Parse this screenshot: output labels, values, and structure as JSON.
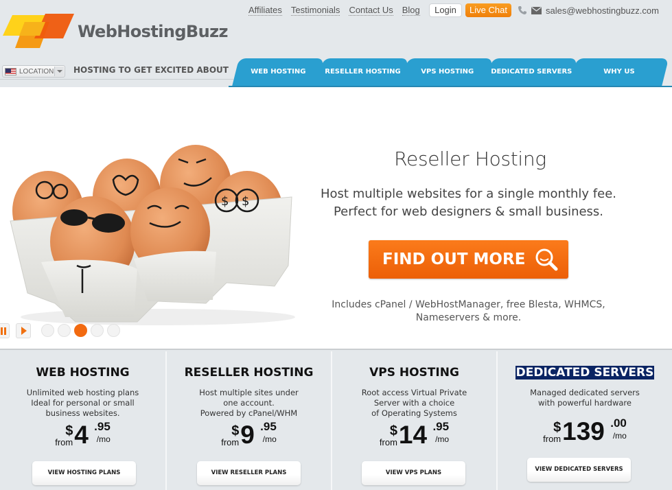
{
  "brand": {
    "name": "WebHostingBuzz",
    "colors": {
      "accent_orange": "#f26a10",
      "nav_blue": "#2a9fd0",
      "live_chat": "#f59216"
    }
  },
  "top_links": [
    "Affiliates",
    "Testimonials",
    "Contact Us",
    "Blog"
  ],
  "header": {
    "login_label": "Login",
    "live_chat_label": "Live Chat",
    "phone_icon": "phone-icon",
    "mail_icon": "mail-icon",
    "email": "sales@webhostingbuzz.com",
    "location_label": "LOCATION",
    "location_flag": "us-flag-icon",
    "tagline": "HOSTING TO GET EXCITED ABOUT"
  },
  "nav": {
    "tabs": [
      "WEB HOSTING",
      "RESELLER HOSTING",
      "VPS HOSTING",
      "DEDICATED SERVERS",
      "WHY US"
    ]
  },
  "hero": {
    "image_alt": "Cartoon-faced eggs in a carton",
    "title": "Reseller Hosting",
    "subtitle_line1": "Host multiple websites for a single monthly fee.",
    "subtitle_line2": "Perfect for web designers & small business.",
    "cta_label": "FIND OUT MORE",
    "cta_icon": "magnifier-icon",
    "note_line1": "Includes cPanel / WebHostManager, free Blesta, WHMCS,",
    "note_line2": "Nameservers & more.",
    "slider": {
      "total_slides": 5,
      "active_slide": 3
    }
  },
  "plans": [
    {
      "title": "WEB HOSTING",
      "selected": false,
      "desc": [
        "Unlimited web hosting plans",
        "Ideal for personal or small",
        "business websites."
      ],
      "from_label": "from",
      "currency": "$",
      "price_whole": "4",
      "price_cents": ".95",
      "period": "/mo",
      "button": "VIEW HOSTING PLANS"
    },
    {
      "title": "RESELLER HOSTING",
      "selected": false,
      "desc": [
        "Host multiple sites under",
        "one account.",
        "Powered by cPanel/WHM"
      ],
      "from_label": "from",
      "currency": "$",
      "price_whole": "9",
      "price_cents": ".95",
      "period": "/mo",
      "button": "VIEW RESELLER PLANS"
    },
    {
      "title": "VPS HOSTING",
      "selected": false,
      "desc": [
        "Root access Virtual Private",
        "Server with a choice",
        "of Operating Systems"
      ],
      "from_label": "from",
      "currency": "$",
      "price_whole": "14",
      "price_cents": ".95",
      "period": "/mo",
      "button": "VIEW VPS PLANS"
    },
    {
      "title": "DEDICATED SERVERS",
      "selected": true,
      "desc": [
        "Managed dedicated servers",
        "with powerful hardware"
      ],
      "from_label": "from",
      "currency": "$",
      "price_whole": "139",
      "price_cents": ".00",
      "period": "/mo",
      "button": "VIEW DEDICATED SERVERS"
    }
  ]
}
